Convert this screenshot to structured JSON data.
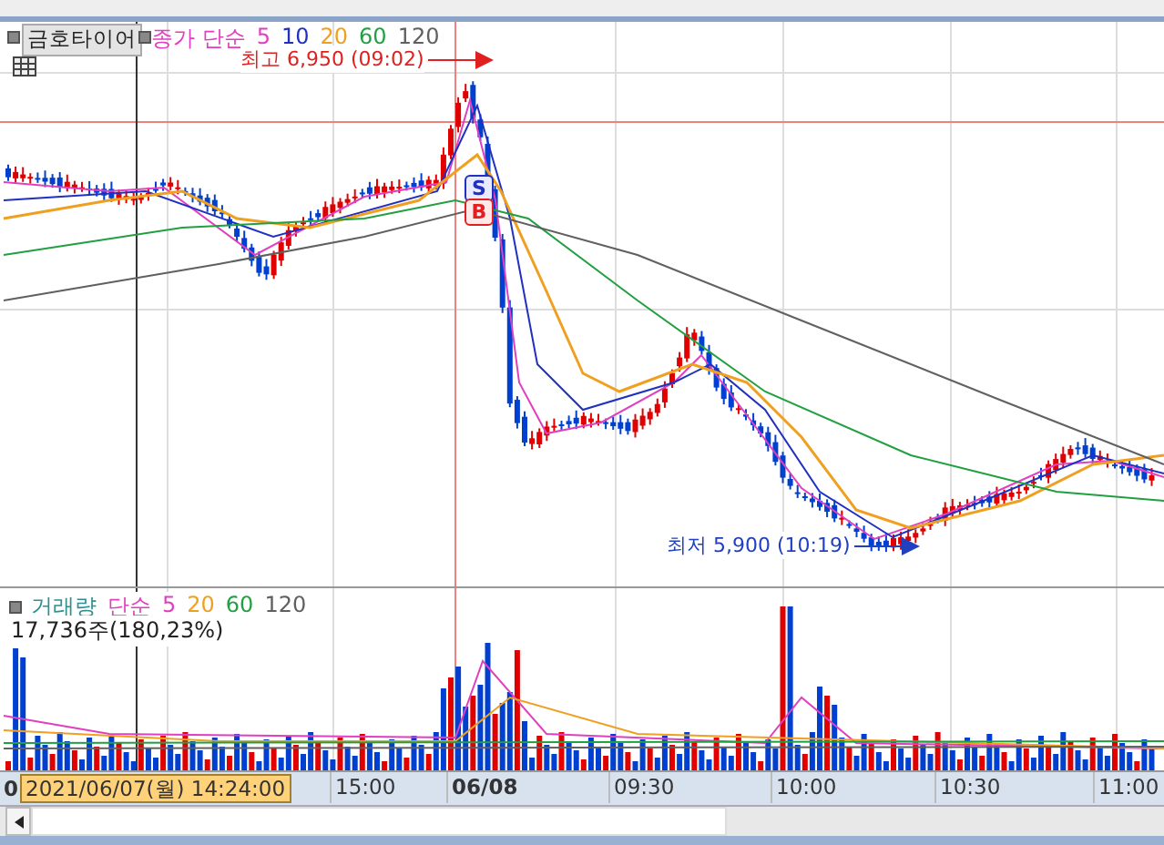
{
  "stock_button": "금호타이어",
  "price_legend": {
    "label": "종가 단순",
    "periods": [
      {
        "text": "5",
        "color": "#e040c0"
      },
      {
        "text": "10",
        "color": "#2030c0"
      },
      {
        "text": "20",
        "color": "#f0a020"
      },
      {
        "text": "60",
        "color": "#20a040"
      },
      {
        "text": "120",
        "color": "#606060"
      }
    ]
  },
  "high_marker": "최고 6,950 (09:02)",
  "low_marker": "최저 5,900 (10:19)",
  "signals": [
    {
      "text": "S",
      "kind": "sell"
    },
    {
      "text": "B",
      "kind": "buy"
    }
  ],
  "volume_legend": {
    "label": "거래량",
    "method": "단순",
    "periods": [
      {
        "text": "5",
        "color": "#e040c0"
      },
      {
        "text": "20",
        "color": "#f0a020"
      },
      {
        "text": "60",
        "color": "#20a040"
      },
      {
        "text": "120",
        "color": "#606060"
      }
    ]
  },
  "volume_reading": "17,736주(180,23%)",
  "time_axis": {
    "start_label": "0",
    "cursor_label": "2021/06/07(월) 14:24:00",
    "ticks": [
      {
        "text": "15:00",
        "bold": false
      },
      {
        "text": "06/08",
        "bold": true
      },
      {
        "text": "09:30",
        "bold": false
      },
      {
        "text": "10:00",
        "bold": false
      },
      {
        "text": "10:30",
        "bold": false
      },
      {
        "text": "11:00",
        "bold": false
      }
    ]
  }
}
